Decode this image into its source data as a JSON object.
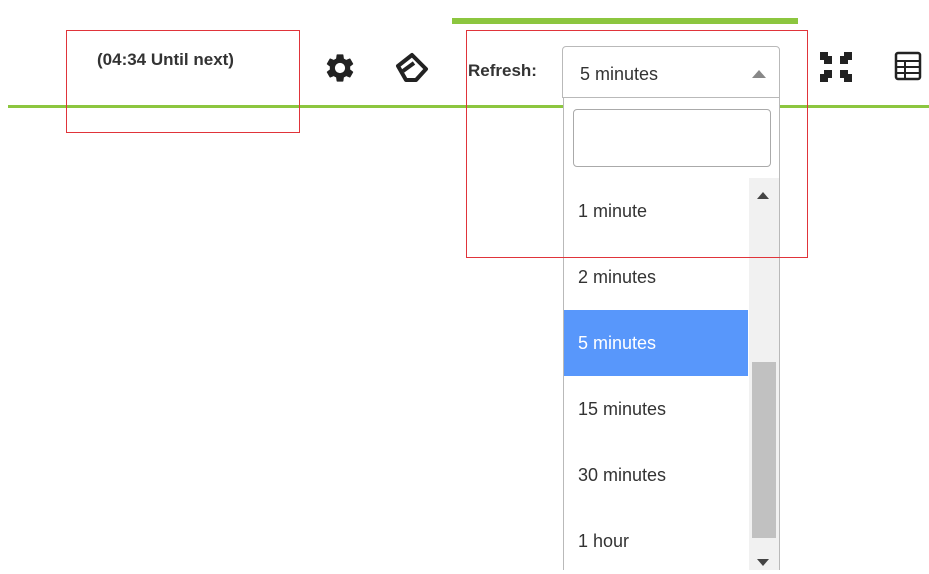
{
  "header": {
    "countdown_text": "(04:34 Until next)",
    "refresh_label": "Refresh:",
    "accent_color": "#8cc63f"
  },
  "icons": {
    "settings": "gear-icon",
    "clear": "eraser-icon",
    "collapse": "collapse-arrows-icon",
    "table": "table-icon"
  },
  "refresh_select": {
    "selected_value": "5 minutes",
    "search_value": "",
    "options": [
      {
        "label": "1 minute",
        "selected": false
      },
      {
        "label": "2 minutes",
        "selected": false
      },
      {
        "label": "5 minutes",
        "selected": true
      },
      {
        "label": "15 minutes",
        "selected": false
      },
      {
        "label": "30 minutes",
        "selected": false
      },
      {
        "label": "1 hour",
        "selected": false
      }
    ],
    "selected_color": "#5897fb"
  },
  "annotation_color": "#e0343a"
}
